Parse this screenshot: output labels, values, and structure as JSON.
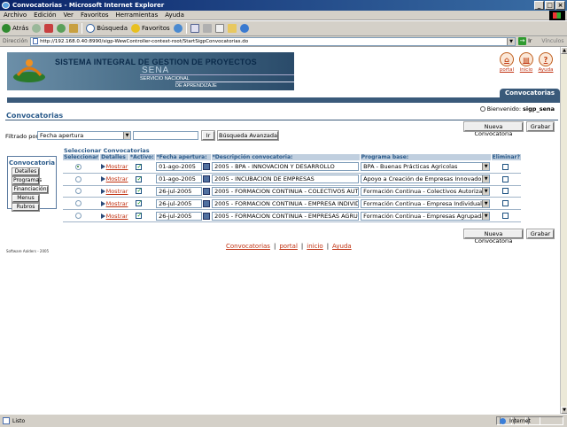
{
  "window": {
    "title": "Convocatorias - Microsoft Internet Explorer",
    "min": "_",
    "max": "□",
    "close": "×"
  },
  "menu": [
    "Archivo",
    "Edición",
    "Ver",
    "Favoritos",
    "Herramientas",
    "Ayuda"
  ],
  "toolbar": {
    "back": "Atrás",
    "search": "Búsqueda",
    "favorites": "Favoritos"
  },
  "address": {
    "label": "Dirección",
    "url": "http://192.168.0.40:8990/sigp-WewController-context-root/StartSigpConvocatorias.do",
    "go": "Ir",
    "links": "Vínculos"
  },
  "status": {
    "text": "Listo",
    "zone": "Internet"
  },
  "banner": {
    "title": "SISTEMA INTEGRAL DE GESTION DE PROYECTOS",
    "sena": "SENA",
    "sub1": "SERVICIO NACIONAL",
    "sub2": "DE APRENDIZAJE"
  },
  "toplinks": {
    "portal": "portal",
    "inicio": "inicio",
    "ayuda": "Ayuda"
  },
  "tab": "Convocatorias",
  "welcome": {
    "label": "Bienvenido:",
    "user": "sigp_sena"
  },
  "page_title": "Convocatorias",
  "buttons": {
    "nueva": "Nueva Convocatoria",
    "grabar": "Grabar",
    "ir": "Ir",
    "busqueda": "Búsqueda Avanzada"
  },
  "filter": {
    "label": "Filtrado por",
    "selected": "Fecha apertura"
  },
  "leftnav": {
    "title": "Convocatoria",
    "items": [
      "Detalles",
      "Programas",
      "Financiación",
      "Menus",
      "Rubros"
    ]
  },
  "table": {
    "title": "Seleccionar Convocatorias",
    "headers": [
      "Seleccionar",
      "Detalles",
      "*Activo:",
      "*Fecha apertura:",
      "*Descripción convocatoria:",
      "Programa base:",
      "Eliminar?"
    ],
    "link_text": "Mostrar",
    "rows": [
      {
        "selected": true,
        "active": true,
        "date": "01-ago-2005",
        "desc": "2005 - BPA - INNOVACION Y DESARROLLO",
        "program": "BPA - Buenas Prácticas Agricolas",
        "delete": false
      },
      {
        "selected": false,
        "active": true,
        "date": "01-ago-2005",
        "desc": "2005 - INCUBACION DE EMPRESAS",
        "program": "Apoyo a Creación de Empresas Innovadoras",
        "delete": false
      },
      {
        "selected": false,
        "active": true,
        "date": "26-jul-2005",
        "desc": "2005 - FORMACION CONTINUA - COLECTIVOS AUTORIZADOS",
        "program": "Formación Continua - Colectivos Autorizados",
        "delete": false
      },
      {
        "selected": false,
        "active": true,
        "date": "26-jul-2005",
        "desc": "2005 - FORMACION CONTINUA - EMPRESA INDIVIDUAL",
        "program": "Formación Continua - Empresa Individual",
        "delete": false
      },
      {
        "selected": false,
        "active": true,
        "date": "26-jul-2005",
        "desc": "2005 - FORMACION CONTINUA - EMPRESAS AGRUPADAS",
        "program": "Formación Continua - Empresas Agrupadas",
        "delete": false
      }
    ]
  },
  "footer": {
    "links": [
      "Convocatorias",
      "portal",
      "inicio",
      "Ayuda"
    ],
    "copyright": "Software Aalders - 2005"
  },
  "colors": {
    "accent": "#3a5a7a",
    "link": "#c03010",
    "header_bg": "#c0cfdf"
  }
}
